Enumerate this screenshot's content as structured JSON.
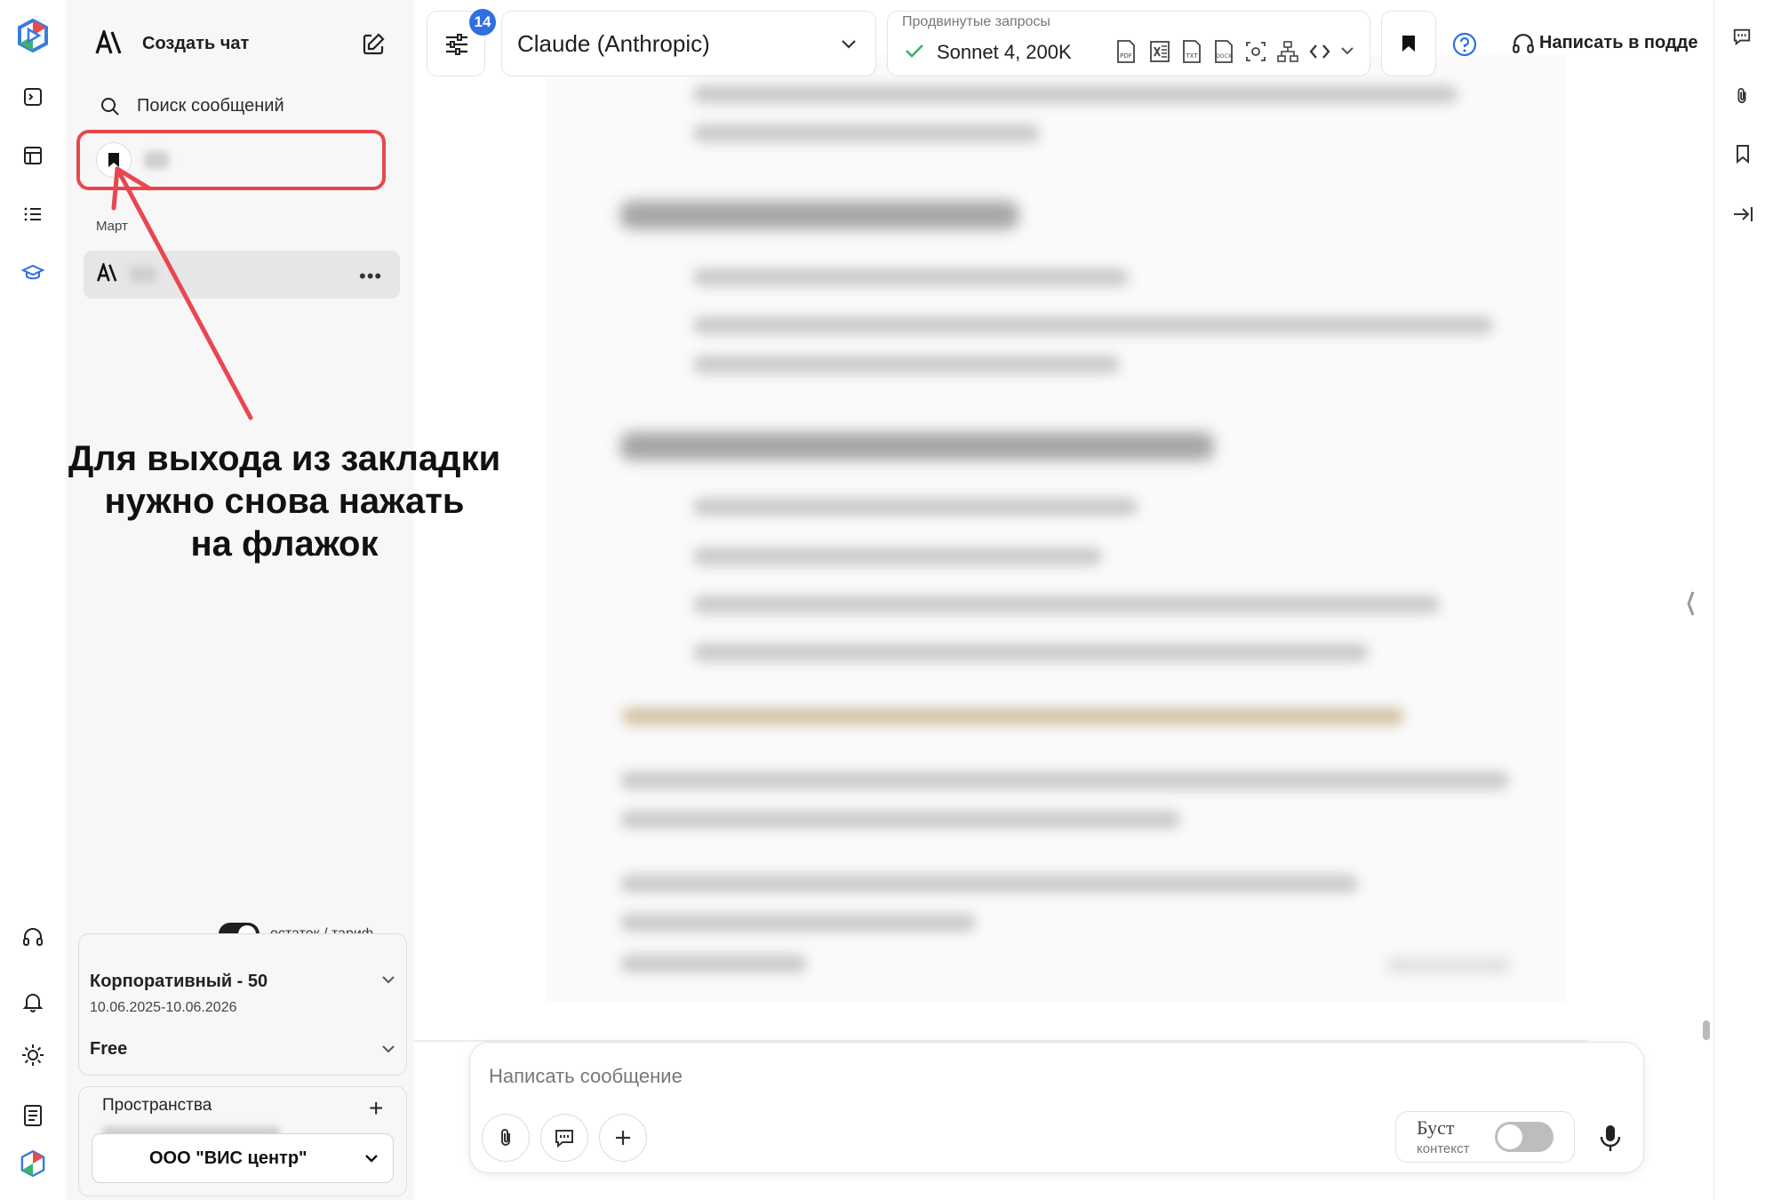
{
  "sidebar": {
    "create_chat": "Создать чат",
    "search_placeholder": "Поиск сообщений",
    "month": "Март",
    "toggle_label": "остаток / тариф",
    "plan_name": "Корпоративный - 50",
    "plan_dates": "10.06.2025-10.06.2026",
    "plan_free": "Free",
    "spaces_label": "Пространства",
    "org_name": "ООО \"ВИС центр\""
  },
  "topbar": {
    "badge_count": "14",
    "model_provider": "Claude (Anthropic)",
    "advanced_label": "Продвинутые запросы",
    "advanced_model": "Sonnet 4, 200K",
    "support_label": "Написать в подде"
  },
  "composer": {
    "placeholder": "Написать сообщение",
    "boost_title": "Буст",
    "boost_sub": "контекст"
  },
  "annotation": {
    "line1": "Для выхода из закладки",
    "line2": "нужно снова нажать",
    "line3": "на флажок"
  },
  "colors": {
    "accent_blue": "#2f6fe0",
    "annotation_red": "#e8474f",
    "toggle_dark": "#1f1f1f"
  }
}
